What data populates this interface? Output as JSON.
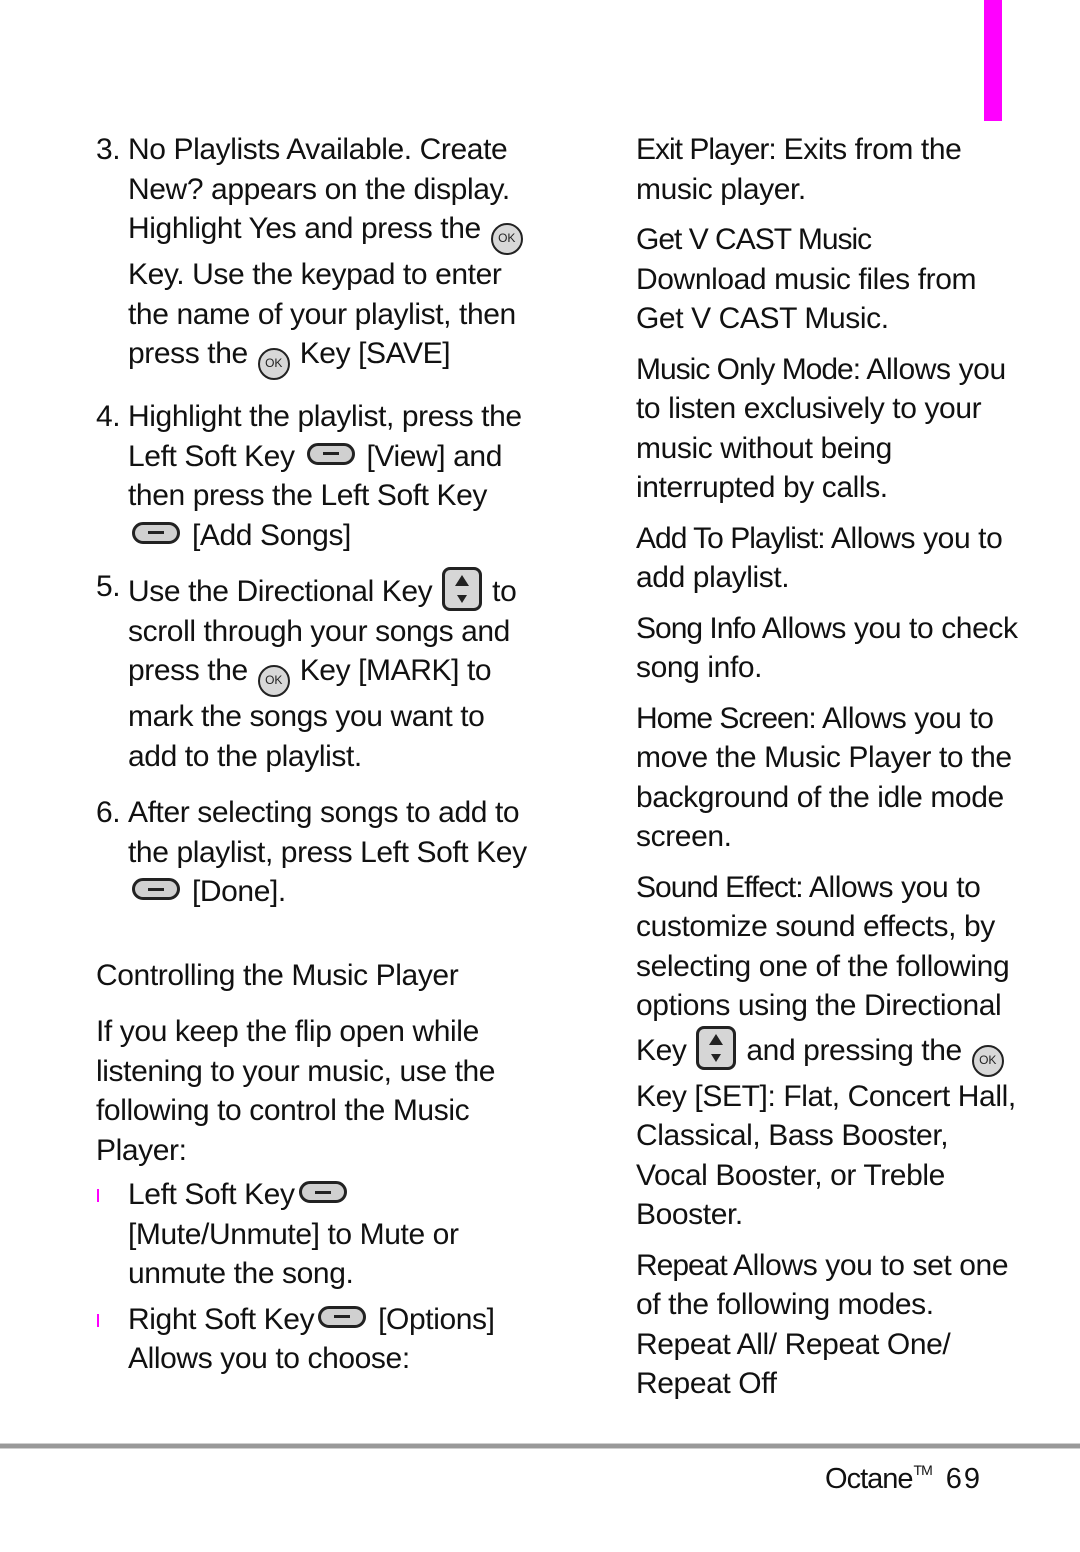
{
  "page": {
    "accent_color": "#ff00ff",
    "footer": {
      "product": "Octane",
      "trademark": "TM",
      "page_number": "69"
    }
  },
  "left_column": {
    "steps": [
      {
        "number": "3.",
        "parts": [
          "No Playlists Available. Create New?  appears on the display. Highlight Yes and press the",
          "Key. Use the keypad to enter the name of your playlist, then press the",
          "Key [SAVE]"
        ]
      },
      {
        "number": "4.",
        "parts": [
          "Highlight the playlist, press the Left Soft Key",
          "[View] and then press the Left Soft Key",
          "[Add Songs]"
        ]
      },
      {
        "number": "5.",
        "parts": [
          "Use the Directional Key",
          "to scroll through your songs and press the",
          "Key [MARK] to mark the songs you want to add to the playlist."
        ]
      },
      {
        "number": "6.",
        "parts": [
          "After selecting songs to add to the playlist, press Left Soft Key",
          "[Done]."
        ]
      }
    ],
    "section_title": "Controlling the Music Player",
    "intro": "If you keep the flip open while listening to your music, use the following to control the Music Player:",
    "bullets": [
      {
        "lead": "Left Soft Key",
        "rest": "[Mute/Unmute]  to Mute or unmute the song."
      },
      {
        "lead": "Right Soft Key",
        "rest": "[Options] Allows you to choose:"
      }
    ]
  },
  "right_column": {
    "entries": [
      {
        "term": "Exit Player:",
        "desc": "Exits from the music player."
      },
      {
        "term": "Get V CAST Music",
        "desc": "Download music files from Get V CAST Music."
      },
      {
        "term": "Music Only Mode:",
        "desc": "Allows you to listen exclusively to your music without being interrupted by calls."
      },
      {
        "term": "Add To Playlist:",
        "desc": "Allows you to add playlist."
      },
      {
        "term": "Song Info",
        "desc": "Allows you to check song info."
      },
      {
        "term": "Home Screen:",
        "desc": "Allows you to move the Music Player to the background of the idle mode screen."
      },
      {
        "term": "Sound Effect:",
        "desc_parts": [
          "Allows you to customize sound effects, by selecting one of the following options using the Directional Key",
          "and pressing the",
          "Key [SET]: Flat, Concert Hall, Classical, Bass Booster, Vocal Booster, or Treble Booster."
        ]
      },
      {
        "term": "Repeat",
        "desc": "Allows you to set one of the following modes. Repeat All/ Repeat One/ Repeat Off"
      }
    ]
  },
  "icons": {
    "ok_key_label": "OK"
  }
}
